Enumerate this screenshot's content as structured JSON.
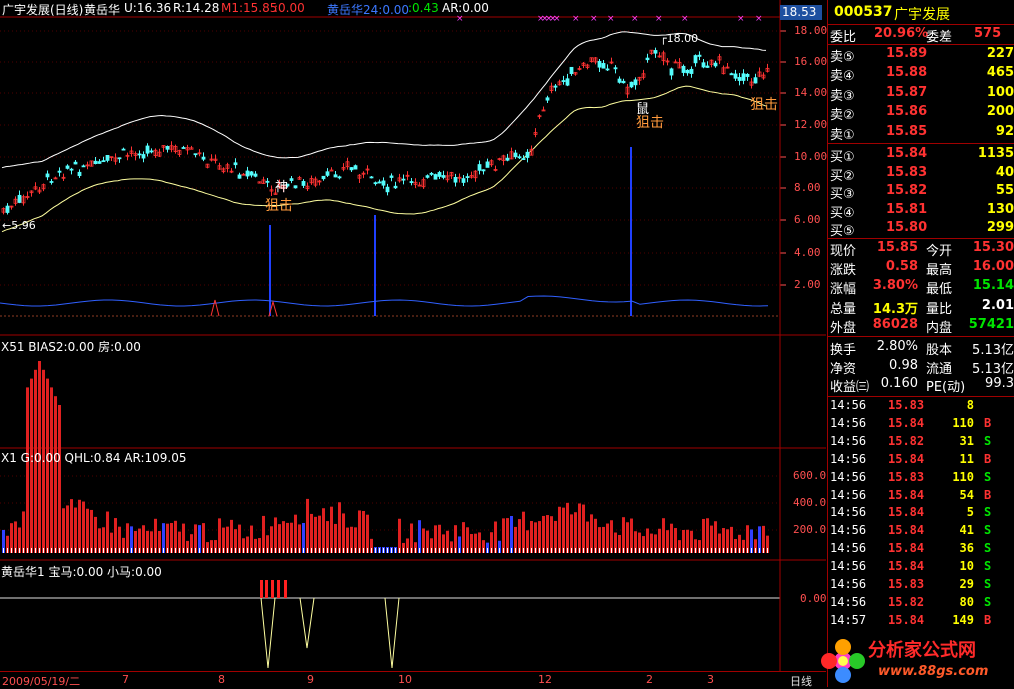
{
  "header": {
    "name_period": "广宇发展(日线)",
    "ind_name": "黄岳华",
    "u": "U:16.36",
    "r": "R:14.28",
    "m1": "M1:15.85",
    "m1b": ":0.00",
    "ind2_name": "黄岳华24:0.00",
    "ind2_v2": ":0.43",
    "ar": "AR:0.00"
  },
  "price_axis": {
    "current_price_tag": "18.53",
    "ticks": [
      "18.00",
      "16.00",
      "14.00",
      "12.00",
      "10.00",
      "8.00",
      "6.00",
      "4.00",
      "2.00"
    ],
    "max_annotation": "18.00",
    "min_annotation": "5.96"
  },
  "annotations": {
    "signal_a": "狙击",
    "signal_b": "狙击",
    "signal_c": "狙击",
    "mark_a": "神",
    "mark_b": "鼠"
  },
  "panel2": {
    "label": "X51 BIAS2:0.00 房:0.00"
  },
  "panel3": {
    "label": "X1 G:0.00 QHL:0.84 AR:109.05",
    "ticks": [
      "600.0",
      "400.0",
      "200.0"
    ]
  },
  "panel4": {
    "label": "黄岳华1 宝马:0.00 小马:0.00",
    "tick": "0.00"
  },
  "date_axis": {
    "start_date": "2009/05/19/二",
    "months": [
      "7",
      "8",
      "9",
      "10",
      "12",
      "2",
      "3"
    ],
    "period": "日线"
  },
  "quote": {
    "code": "000537",
    "name": "广宇发展",
    "ratio_label": "委比",
    "ratio_value": "20.96%",
    "diff_label": "委差",
    "diff_value": "575",
    "asks": [
      {
        "label": "卖⑤",
        "price": "15.89",
        "vol": "227"
      },
      {
        "label": "卖④",
        "price": "15.88",
        "vol": "465"
      },
      {
        "label": "卖③",
        "price": "15.87",
        "vol": "100"
      },
      {
        "label": "卖②",
        "price": "15.86",
        "vol": "200"
      },
      {
        "label": "卖①",
        "price": "15.85",
        "vol": "92"
      }
    ],
    "bids": [
      {
        "label": "买①",
        "price": "15.84",
        "vol": "1135"
      },
      {
        "label": "买②",
        "price": "15.83",
        "vol": "40"
      },
      {
        "label": "买③",
        "price": "15.82",
        "vol": "55"
      },
      {
        "label": "买④",
        "price": "15.81",
        "vol": "130"
      },
      {
        "label": "买⑤",
        "price": "15.80",
        "vol": "299"
      }
    ],
    "stats": [
      {
        "l1": "现价",
        "v1": "15.85",
        "l2": "今开",
        "v2": "15.30"
      },
      {
        "l1": "涨跌",
        "v1": "0.58",
        "l2": "最高",
        "v2": "16.00"
      },
      {
        "l1": "涨幅",
        "v1": "3.80%",
        "l2": "最低",
        "v2": "15.14"
      },
      {
        "l1": "总量",
        "v1": "14.3万",
        "l2": "量比",
        "v2": "2.01"
      },
      {
        "l1": "外盘",
        "v1": "86028",
        "l2": "内盘",
        "v2": "57421"
      }
    ],
    "stats2": [
      {
        "l1": "换手",
        "v1": "2.80%",
        "l2": "股本",
        "v2": "5.13亿"
      },
      {
        "l1": "净资",
        "v1": "0.98",
        "l2": "流通",
        "v2": "5.13亿"
      },
      {
        "l1": "收益㈢",
        "v1": "0.160",
        "l2": "PE(动)",
        "v2": "99.3"
      }
    ]
  },
  "ticks": [
    {
      "t": "14:56",
      "p": "15.83",
      "v": "8",
      "s": ""
    },
    {
      "t": "14:56",
      "p": "15.84",
      "v": "110",
      "s": "B"
    },
    {
      "t": "14:56",
      "p": "15.82",
      "v": "31",
      "s": "S"
    },
    {
      "t": "14:56",
      "p": "15.84",
      "v": "11",
      "s": "B"
    },
    {
      "t": "14:56",
      "p": "15.83",
      "v": "110",
      "s": "S"
    },
    {
      "t": "14:56",
      "p": "15.84",
      "v": "54",
      "s": "B"
    },
    {
      "t": "14:56",
      "p": "15.84",
      "v": "5",
      "s": "S"
    },
    {
      "t": "14:56",
      "p": "15.84",
      "v": "41",
      "s": "S"
    },
    {
      "t": "14:56",
      "p": "15.84",
      "v": "36",
      "s": "S"
    },
    {
      "t": "14:56",
      "p": "15.84",
      "v": "10",
      "s": "S"
    },
    {
      "t": "14:56",
      "p": "15.83",
      "v": "29",
      "s": "S"
    },
    {
      "t": "14:56",
      "p": "15.82",
      "v": "80",
      "s": "S"
    },
    {
      "t": "14:57",
      "p": "15.84",
      "v": "149",
      "s": "B"
    }
  ],
  "watermark": {
    "site_name": "分析家公式网",
    "site_url": "www.88gs.com"
  }
}
